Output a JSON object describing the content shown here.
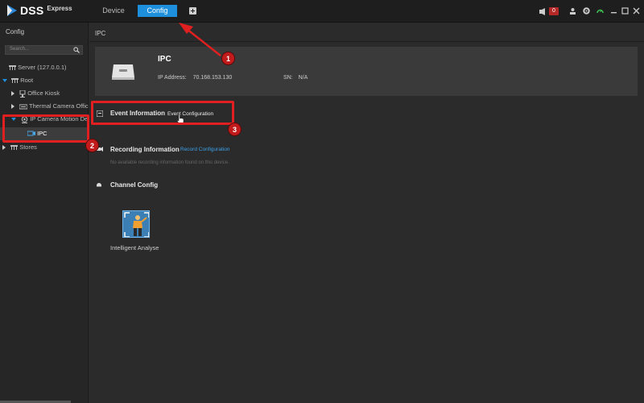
{
  "app": {
    "logo_text": "DSS",
    "logo_sub": "Express",
    "tabs": [
      {
        "label": "Device"
      },
      {
        "label": "Config"
      }
    ],
    "alarm_count": "0"
  },
  "sidebar": {
    "title": "Config",
    "search_placeholder": "Search...",
    "tree": [
      {
        "label": "Server (127.0.0.1)"
      },
      {
        "label": "Root"
      },
      {
        "label": "Office Kiosk"
      },
      {
        "label": "Thermal Camera Office"
      },
      {
        "label": "IP Camera Motion Detection"
      },
      {
        "label": "IPC"
      },
      {
        "label": "Stores"
      }
    ]
  },
  "main": {
    "breadcrumb": "IPC",
    "device": {
      "name": "IPC",
      "ip_label": "IP Address:",
      "ip_value": "70.168.153.130",
      "sn_label": "SN:",
      "sn_value": "N/A"
    },
    "event": {
      "title": "Event Information",
      "link": "Event Configuration"
    },
    "recording": {
      "title": "Recording Information",
      "link": "Record Configuration",
      "note": "No available recording information found on this device."
    },
    "channel": {
      "title": "Channel Config",
      "item_label": "Intelligent Analyse"
    }
  },
  "annotations": {
    "numbers": [
      "1",
      "2",
      "3"
    ],
    "color": "#e02020"
  },
  "colors": {
    "accent": "#1e8fdc",
    "link": "#3ca2ec",
    "alarm": "#b52828"
  }
}
